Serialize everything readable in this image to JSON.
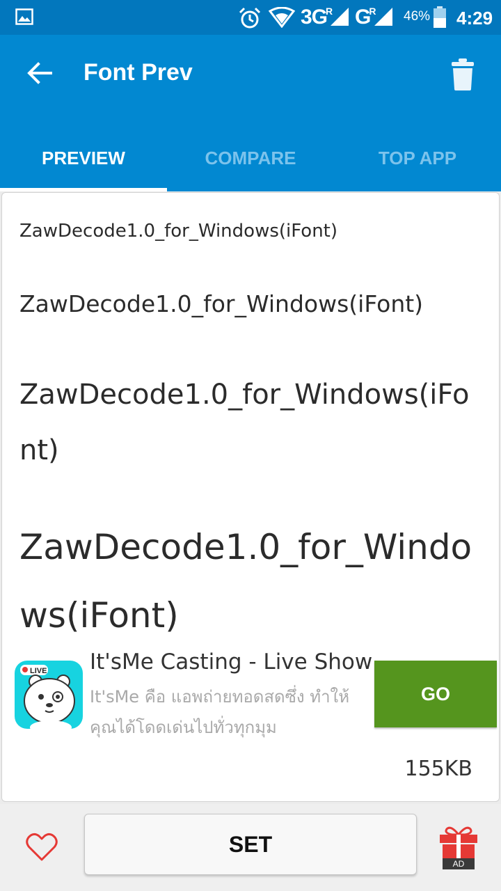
{
  "status_bar": {
    "network_1": "3G",
    "network_1_sup": "R",
    "network_2": "G",
    "network_2_sup": "R",
    "battery": "46%",
    "time": "4:29",
    "icons": [
      "gallery-icon",
      "alarm-icon",
      "wifi-icon",
      "signal-icon",
      "battery-icon"
    ]
  },
  "app_bar": {
    "title": "Font Prev",
    "back_icon": "arrow-left-icon",
    "delete_icon": "trash-icon",
    "color": "#0288d1"
  },
  "tabs": [
    {
      "label": "PREVIEW",
      "active": true
    },
    {
      "label": "COMPARE",
      "active": false
    },
    {
      "label": "TOP APP",
      "active": false
    }
  ],
  "preview": {
    "lines": [
      "ZawDecode1.0_for_Windows(iFont)",
      "ZawDecode1.0_for_Windows(iFont)",
      "ZawDecode1.0_for_Windows(iFont)",
      "ZawDecode1.0_for_Windows(iFont)"
    ]
  },
  "ad": {
    "title": "It'sMe Casting - Live Show",
    "description": "It'sMe คือ แอพถ่ายทอดสดซึ่ง ทำให้คุณได้โดดเด่นไปทั่วทุกมุม",
    "icon_badge": "LIVE",
    "button_label": "GO",
    "button_color": "#55951e",
    "size": "155KB"
  },
  "bottom_bar": {
    "set_label": "SET",
    "gift_label": "AD",
    "heart_icon": "heart-outline-icon",
    "gift_icon": "gift-icon"
  }
}
